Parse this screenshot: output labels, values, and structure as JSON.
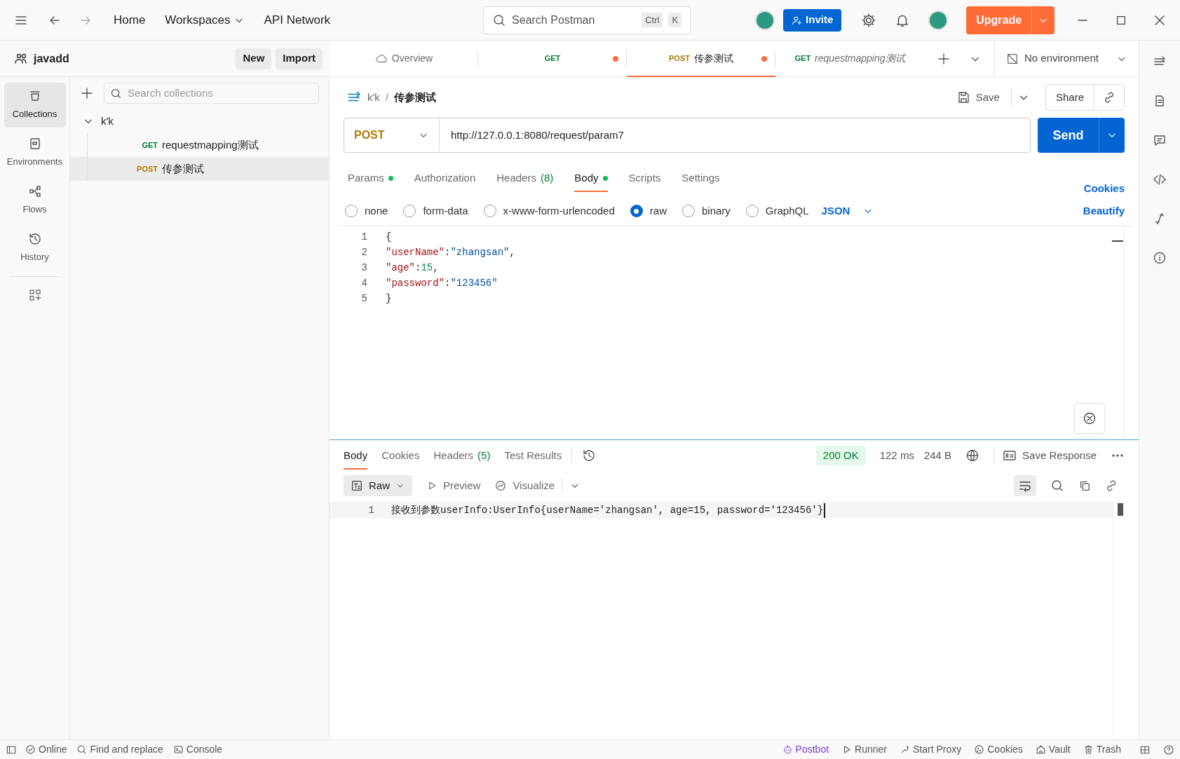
{
  "topbar": {
    "nav": [
      {
        "label": "Home",
        "dropdown": false
      },
      {
        "label": "Workspaces",
        "dropdown": true
      },
      {
        "label": "API Network",
        "dropdown": false
      }
    ],
    "search": {
      "placeholder": "Search Postman",
      "keys": [
        "Ctrl",
        "K"
      ]
    },
    "invite": "Invite",
    "upgrade": "Upgrade"
  },
  "workspace": {
    "name": "javadd",
    "buttons": [
      "New",
      "Import"
    ]
  },
  "rail": [
    {
      "label": "Collections",
      "selected": true
    },
    {
      "label": "Environments",
      "selected": false
    },
    {
      "label": "Flows",
      "selected": false
    },
    {
      "label": "History",
      "selected": false
    }
  ],
  "collections": {
    "placeholder": "Search collections",
    "tree": [
      {
        "label": "k'k",
        "expanded": true,
        "children": [
          {
            "method": "GET",
            "label": "requestmapping测试",
            "selected": false
          },
          {
            "method": "POST",
            "label": "传参测试",
            "selected": true
          }
        ]
      }
    ]
  },
  "tabs": [
    {
      "kind": "overview",
      "label": "Overview",
      "selected": false,
      "unsaved": false,
      "preview": false
    },
    {
      "kind": "request",
      "method": "GET",
      "selected": false,
      "unsaved": true,
      "preview": false
    },
    {
      "kind": "request",
      "method": "POST",
      "label": "传参测试",
      "selected": true,
      "unsaved": true,
      "preview": false
    },
    {
      "kind": "request",
      "method": "GET",
      "label": "requestmapping测试",
      "selected": false,
      "unsaved": false,
      "preview": true
    }
  ],
  "environment": "No environment",
  "breadcrumb": {
    "path": [
      "k'k",
      "传参测试"
    ],
    "separator": "/"
  },
  "actions": {
    "save": "Save",
    "share": "Share"
  },
  "request": {
    "method": "POST",
    "url": "http://127.0.0.1:8080/request/param7",
    "send": "Send"
  },
  "request_tabs": [
    {
      "label": "Params",
      "dot": true,
      "selected": false
    },
    {
      "label": "Authorization",
      "dot": false,
      "selected": false
    },
    {
      "label": "Headers",
      "count": "(8)",
      "dot": false,
      "selected": false
    },
    {
      "label": "Body",
      "dot": true,
      "selected": true
    },
    {
      "label": "Scripts",
      "dot": false,
      "selected": false
    },
    {
      "label": "Settings",
      "dot": false,
      "selected": false
    }
  ],
  "cookies_link": "Cookies",
  "body_types": [
    {
      "label": "none",
      "selected": false
    },
    {
      "label": "form-data",
      "selected": false
    },
    {
      "label": "x-www-form-urlencoded",
      "selected": false
    },
    {
      "label": "raw",
      "selected": true
    },
    {
      "label": "binary",
      "selected": false
    },
    {
      "label": "GraphQL",
      "selected": false
    }
  ],
  "format": "JSON",
  "beautify": "Beautify",
  "editor": [
    {
      "number": "1",
      "tokens": [
        {
          "kind": "punct",
          "text": "{"
        }
      ]
    },
    {
      "number": "2",
      "tokens": [
        {
          "kind": "key",
          "text": "\"userName\""
        },
        {
          "kind": "punct",
          "text": ":"
        },
        {
          "kind": "string",
          "text": "\"zhangsan\""
        },
        {
          "kind": "punct",
          "text": ","
        }
      ]
    },
    {
      "number": "3",
      "tokens": [
        {
          "kind": "key",
          "text": "\"age\""
        },
        {
          "kind": "punct",
          "text": ":"
        },
        {
          "kind": "number",
          "text": "15"
        },
        {
          "kind": "punct",
          "text": ","
        }
      ]
    },
    {
      "number": "4",
      "tokens": [
        {
          "kind": "key",
          "text": "\"password\""
        },
        {
          "kind": "punct",
          "text": ":"
        },
        {
          "kind": "string",
          "text": "\"123456\""
        }
      ]
    },
    {
      "number": "5",
      "tokens": [
        {
          "kind": "punct",
          "text": "}"
        }
      ]
    }
  ],
  "response_tabs": [
    {
      "label": "Body",
      "selected": true
    },
    {
      "label": "Cookies",
      "selected": false
    },
    {
      "label": "Headers",
      "count": "(5)",
      "selected": false
    },
    {
      "label": "Test Results",
      "selected": false
    }
  ],
  "response_meta": {
    "status": "200 OK",
    "time": "122 ms",
    "size": "244 B",
    "save": "Save Response"
  },
  "response_view": {
    "mode": "Raw",
    "preview": "Preview",
    "visualize": "Visualize"
  },
  "response_body": [
    {
      "number": "1",
      "text": "接收到参数userInfo:UserInfo{userName='zhangsan', age=15, password='123456'}"
    }
  ],
  "statusbar": {
    "left": [
      "Online",
      "Find and replace",
      "Console"
    ],
    "right": [
      "Postbot",
      "Runner",
      "Start Proxy",
      "Cookies",
      "Vault",
      "Trash"
    ]
  }
}
